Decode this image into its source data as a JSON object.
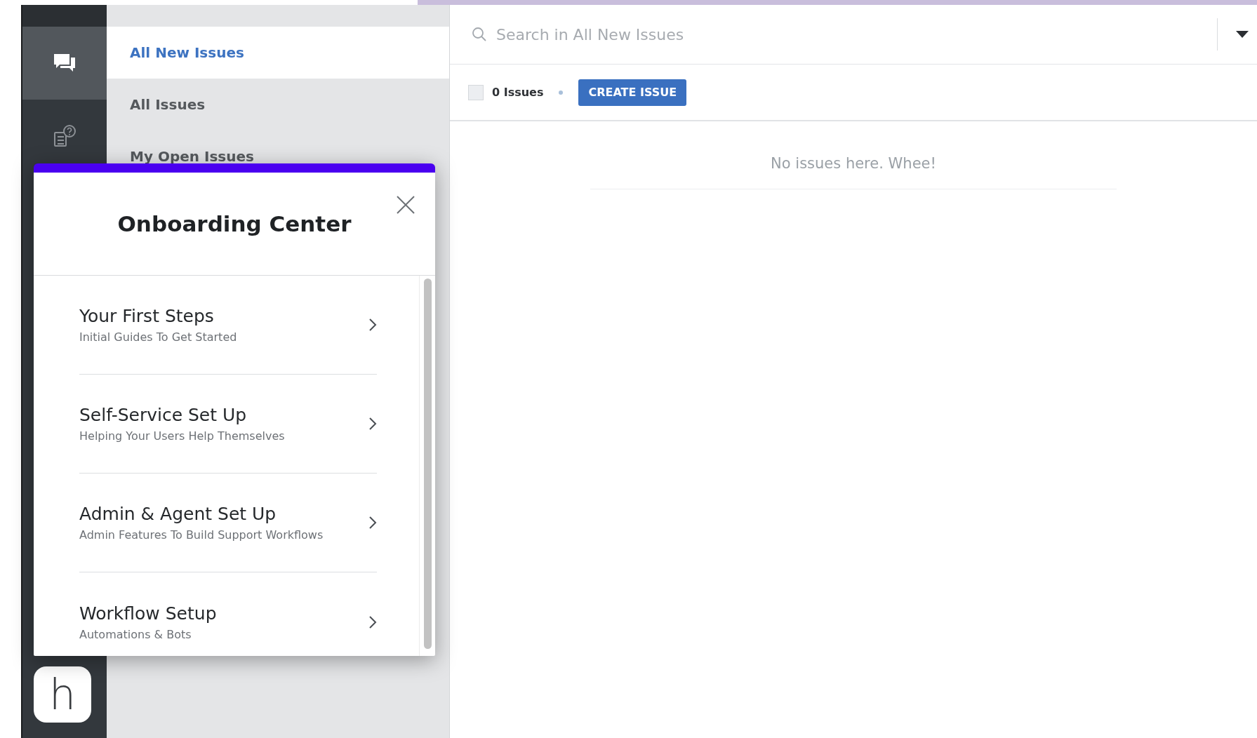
{
  "rail": {
    "items": [
      {
        "kind": "chat",
        "selected": true
      },
      {
        "kind": "help",
        "selected": false
      }
    ],
    "logo": "h"
  },
  "views": [
    {
      "label": "All New Issues",
      "selected": true
    },
    {
      "label": "All Issues",
      "selected": false
    },
    {
      "label": "My Open Issues",
      "selected": false
    }
  ],
  "search": {
    "placeholder": "Search in All New Issues"
  },
  "toolbar": {
    "select_all_checked": false,
    "count": "0 Issues",
    "create_button": "CREATE ISSUE"
  },
  "empty_message": "No issues here. Whee!",
  "onboarding": {
    "title": "Onboarding Center",
    "items": [
      {
        "title": "Your First Steps",
        "subtitle": "Initial Guides To Get Started"
      },
      {
        "title": "Self-Service Set Up",
        "subtitle": "Helping Your Users Help Themselves"
      },
      {
        "title": "Admin & Agent Set Up",
        "subtitle": "Admin Features To Build Support Workflows"
      },
      {
        "title": "Workflow Setup",
        "subtitle": "Automations & Bots"
      }
    ]
  }
}
